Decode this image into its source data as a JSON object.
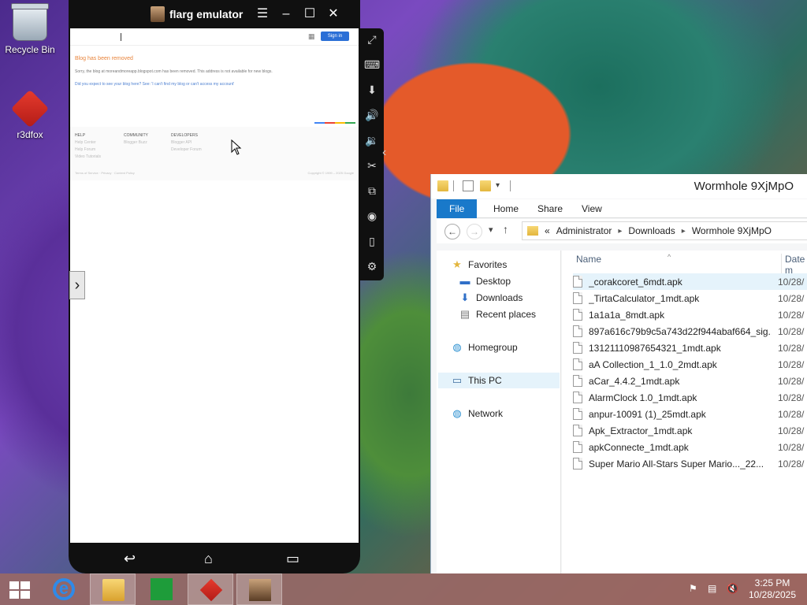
{
  "desktop": {
    "icons": [
      {
        "label": "Recycle Bin"
      },
      {
        "label": "r3dfox"
      }
    ]
  },
  "emulator": {
    "title": "flarg emulator",
    "window_buttons": [
      "menu",
      "minimize",
      "maximize",
      "close"
    ],
    "side_toolbar": [
      "fullscreen-icon",
      "keyboard-icon",
      "apk-install-icon",
      "volume-up-icon",
      "volume-down-icon",
      "screenshot-icon",
      "multi-instance-icon",
      "location-icon",
      "shake-icon",
      "settings-icon"
    ],
    "page": {
      "signin": "Sign in",
      "heading": "Blog has been removed",
      "message": "Sorry, the blog at moreandmoreapp.blogspot.com has been removed. This address is not available for new blogs.",
      "link": "Did you expect to see your blog here? See: 'I can't find my blog or can't access my account'",
      "footer_cols": [
        {
          "title": "HELP",
          "items": [
            "Help Center",
            "Help Forum",
            "Video Tutorials"
          ]
        },
        {
          "title": "COMMUNITY",
          "items": [
            "Blogger Buzz"
          ]
        },
        {
          "title": "DEVELOPERS",
          "items": [
            "Blogger API",
            "Developer Forum"
          ]
        }
      ],
      "bottom_links": "Terms of Service · Privacy · Content Policy",
      "copyright": "Copyright © 1999 – 2025 Google"
    }
  },
  "explorer": {
    "title": "Wormhole 9XjMpO",
    "ribbon_tabs": [
      "File",
      "Home",
      "Share",
      "View"
    ],
    "address": {
      "prefix": "«",
      "parts": [
        "Administrator",
        "Downloads",
        "Wormhole 9XjMpO"
      ]
    },
    "nav": {
      "favorites": "Favorites",
      "desktop": "Desktop",
      "downloads": "Downloads",
      "recent": "Recent places",
      "homegroup": "Homegroup",
      "thispc": "This PC",
      "network": "Network"
    },
    "columns": {
      "name": "Name",
      "date": "Date m"
    },
    "files": [
      {
        "name": "_corakcoret_6mdt.apk",
        "date": "10/28/"
      },
      {
        "name": "_TirtaCalculator_1mdt.apk",
        "date": "10/28/"
      },
      {
        "name": "1a1a1a_8mdt.apk",
        "date": "10/28/"
      },
      {
        "name": "897a616c79b9c5a743d22f944abaf664_sig...",
        "date": "10/28/"
      },
      {
        "name": "13121110987654321_1mdt.apk",
        "date": "10/28/"
      },
      {
        "name": "aA Collection_1_1.0_2mdt.apk",
        "date": "10/28/"
      },
      {
        "name": "aCar_4.4.2_1mdt.apk",
        "date": "10/28/"
      },
      {
        "name": "AlarmClock 1.0_1mdt.apk",
        "date": "10/28/"
      },
      {
        "name": "anpur-10091 (1)_25mdt.apk",
        "date": "10/28/"
      },
      {
        "name": "Apk_Extractor_1mdt.apk",
        "date": "10/28/"
      },
      {
        "name": "apkConnecte_1mdt.apk",
        "date": "10/28/"
      },
      {
        "name": "Super Mario All-Stars  Super Mario..._22...",
        "date": "10/28/"
      }
    ]
  },
  "taskbar": {
    "clock_time": "3:25 PM",
    "clock_date": "10/28/2025"
  }
}
